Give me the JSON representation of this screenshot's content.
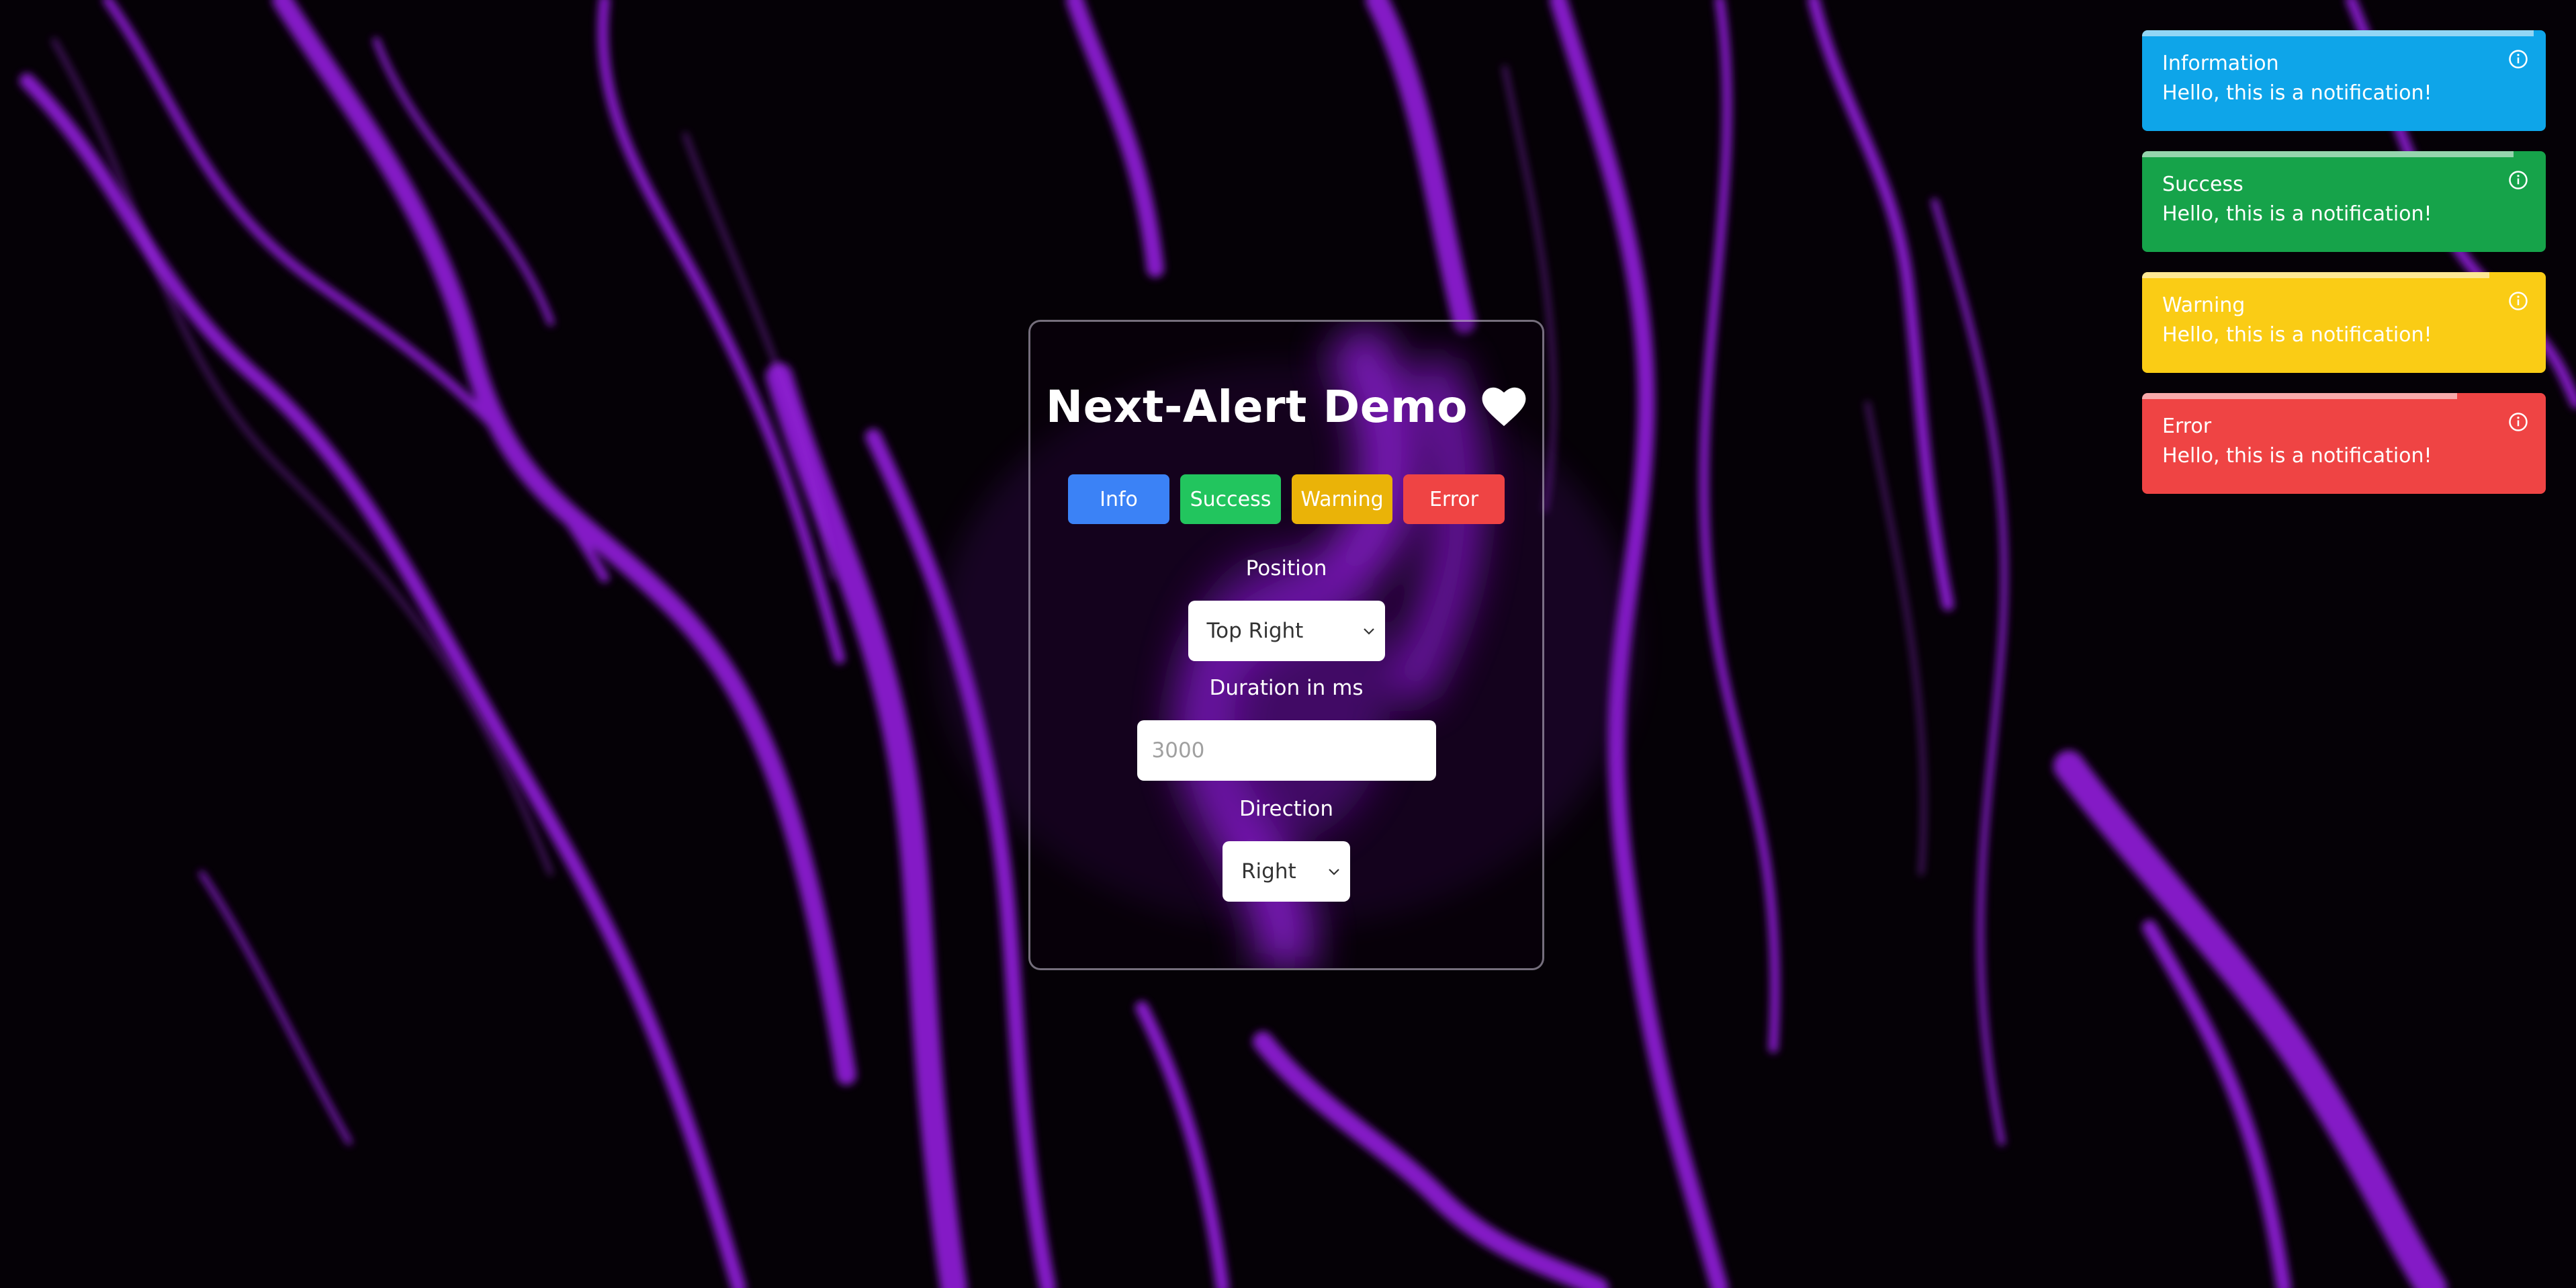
{
  "demo": {
    "title": "Next-Alert Demo",
    "buttons": {
      "info": "Info",
      "success": "Success",
      "warning": "Warning",
      "error": "Error"
    },
    "position": {
      "label": "Position",
      "selected": "Top Right"
    },
    "duration": {
      "label": "Duration in ms",
      "placeholder": "3000"
    },
    "direction": {
      "label": "Direction",
      "selected": "Right"
    }
  },
  "notifications": [
    {
      "type": "info",
      "title": "Information",
      "message": "Hello, this is a notification!",
      "color": "#0ea5e9",
      "remaining": 0.97
    },
    {
      "type": "success",
      "title": "Success",
      "message": "Hello, this is a notification!",
      "color": "#16a34a",
      "remaining": 0.92
    },
    {
      "type": "warning",
      "title": "Warning",
      "message": "Hello, this is a notification!",
      "color": "#facc15",
      "remaining": 0.86
    },
    {
      "type": "error",
      "title": "Error",
      "message": "Hello, this is a notification!",
      "color": "#ef4444",
      "remaining": 0.78
    }
  ],
  "colors": {
    "accent_purple": "#8b1fd1",
    "background": "#050106",
    "btn_info": "#3b82f6",
    "btn_success": "#22c55e",
    "btn_warning": "#eab308",
    "btn_error": "#ef4444"
  },
  "icons": {
    "title_icon": "heart-icon",
    "toast_icon": "info-circle-icon",
    "select_icon": "chevron-down-icon"
  }
}
